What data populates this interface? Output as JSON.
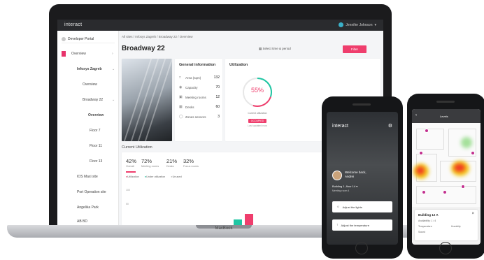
{
  "laptop": {
    "brand_label": "MacBook",
    "topbar": {
      "logo": "interact",
      "user_name": "Jennifer Johnson"
    },
    "sidebar": {
      "project_selector": "Developer Portal",
      "items": [
        {
          "label": "Overview"
        },
        {
          "label": "Infosys Zagreb"
        },
        {
          "label": "Overview"
        },
        {
          "label": "Broadway 22"
        },
        {
          "label": "Overview"
        },
        {
          "label": "Floor 7"
        },
        {
          "label": "Floor 11"
        },
        {
          "label": "Floor 13"
        },
        {
          "label": "IOS Maxi site"
        },
        {
          "label": "Port Operation site"
        },
        {
          "label": "Angelika Park"
        },
        {
          "label": "AB BD"
        }
      ]
    },
    "main": {
      "breadcrumb": "All sites  /  Infosys Zagreb  /  Broadway 22  /  Overview",
      "page_title": "Broadway 22",
      "selector_label": "Select time & period",
      "primary_button": "Filter",
      "general_info": {
        "title": "General information",
        "rows": [
          {
            "icon": "area-icon",
            "label": "Area (sqm)",
            "value": "132"
          },
          {
            "icon": "capacity-icon",
            "label": "Capacity",
            "value": "70"
          },
          {
            "icon": "meeting-icon",
            "label": "Meeting rooms",
            "value": "12"
          },
          {
            "icon": "desk-icon",
            "label": "Desks",
            "value": "60"
          },
          {
            "icon": "sensor-icon",
            "label": "Zones sensors",
            "value": "3"
          }
        ]
      },
      "utilization": {
        "title": "Utilization",
        "gauge_value": "55%",
        "gauge_fraction": 0.55,
        "caption": "Current utilization",
        "badge": "OCCUPIED",
        "sub_caption": "Last updated now"
      },
      "current": {
        "section_title": "Current Utilization",
        "kpis": [
          {
            "value": "42%",
            "caption": "Overall"
          },
          {
            "value": "72%",
            "caption": "Meeting rooms"
          },
          {
            "value": "21%",
            "caption": "Desks"
          },
          {
            "value": "32%",
            "caption": "Focus rooms"
          }
        ],
        "legend": [
          "Utilization",
          "Under utilization",
          "Unused"
        ],
        "axis_label_top": "100",
        "axis_label_bottom": "50"
      }
    }
  },
  "phone_left": {
    "logo": "interact",
    "welcome_line1": "Welcome back,",
    "welcome_line2": "Andrei",
    "location": "Building 1, floor 14",
    "location_sub": "Meeting room 4",
    "actions": [
      {
        "icon": "light-icon",
        "label": "Adjust the lights"
      },
      {
        "icon": "temperature-icon",
        "label": "Adjust the temperature"
      }
    ]
  },
  "phone_right": {
    "header": "Levels",
    "panel": {
      "title": "Building 12 A",
      "lines": [
        "Availability: 1 / 4",
        "Temperature",
        "Humidity",
        "Sound"
      ]
    },
    "colors": {
      "heat_hot": "#f03c24",
      "heat_warm": "#f4c81c",
      "heat_cool": "#6bcf5b",
      "pin": "#c22f8e"
    }
  },
  "colors": {
    "accent": "#ef3e6d",
    "teal": "#1fc6a3",
    "topbar": "#2a2b2e"
  }
}
